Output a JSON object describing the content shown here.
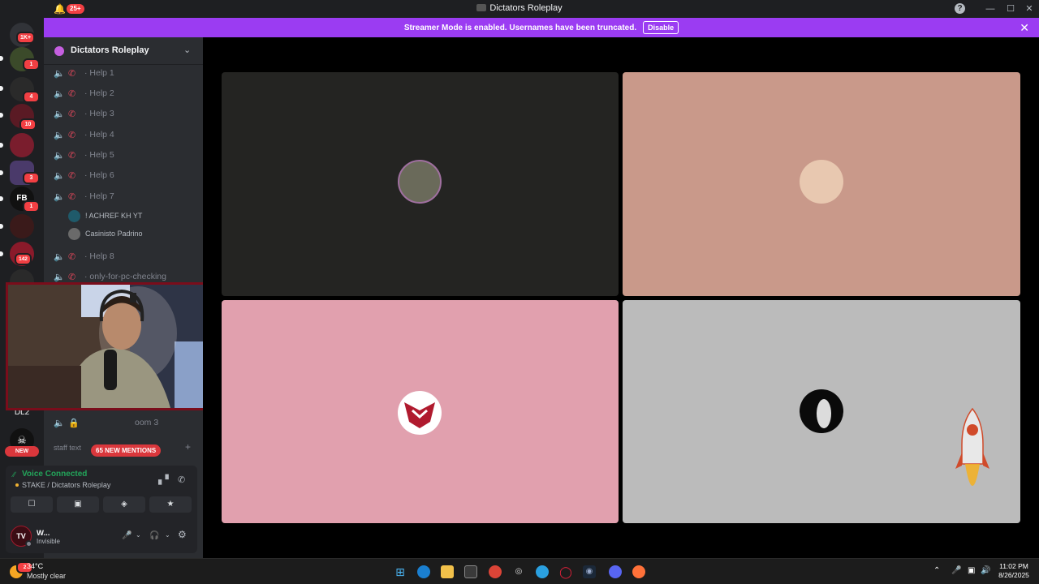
{
  "window": {
    "title": "Dictators Roleplay",
    "notifications_badge": "25+"
  },
  "banner": {
    "text": "Streamer Mode is enabled. Usernames have been truncated.",
    "disable_label": "Disable"
  },
  "rail": {
    "badges": [
      "1K+",
      "1",
      "4",
      "10",
      "3",
      "1",
      "142"
    ],
    "dl2_label": "DL2",
    "new_label": "NEW"
  },
  "guild": {
    "name": "Dictators Roleplay",
    "channels": [
      "Help 1",
      "Help 2",
      "Help 3",
      "Help 4",
      "Help 5",
      "Help 6",
      "Help 7",
      "Help 8",
      "only-for-pc-checking",
      "oom 3"
    ],
    "voice_users": [
      "! ACHREF KH YT",
      "Casinisto Padrino"
    ],
    "staff_text": "staff text",
    "mentions": "65 NEW MENTIONS"
  },
  "voice_panel": {
    "status": "Voice Connected",
    "location": "STAKE / Dictators Roleplay"
  },
  "user": {
    "name": "W...",
    "status": "Invisible"
  },
  "taskbar": {
    "temperature": "34°C",
    "weather": "Mostly clear",
    "weather_badge": "2",
    "time": "11:02 PM",
    "date": "8/26/2025"
  },
  "colors": {
    "banner": "#9b3cf2",
    "tile1": "#242422",
    "tile2": "#c9998a",
    "tile3": "#e1a0ae",
    "tile4": "#bbbbbb",
    "voice_green": "#23a55a"
  }
}
